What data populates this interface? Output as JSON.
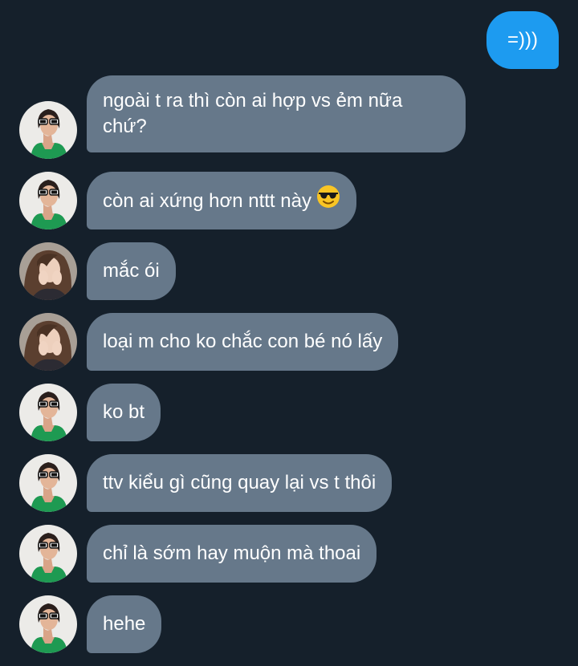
{
  "colors": {
    "background": "#15202b",
    "sent_bubble": "#1d9bf0",
    "received_bubble": "#66788a",
    "text": "#ffffff"
  },
  "conversation": {
    "sent": [
      {
        "text": "=)))"
      }
    ],
    "received": [
      {
        "text": "ngoài t ra thì còn ai hợp vs ẻm nữa chứ?",
        "avatar": "sunglasses-woman-avatar"
      },
      {
        "text": "còn ai xứng hơn nttt này",
        "emoji": "smiling-face-with-sunglasses-emoji",
        "avatar": "sunglasses-woman-avatar"
      },
      {
        "text": "mắc ói",
        "avatar": "long-hair-woman-avatar"
      },
      {
        "text": "loại m cho ko chắc con bé nó lấy",
        "avatar": "long-hair-woman-avatar"
      },
      {
        "text": "ko bt",
        "avatar": "sunglasses-woman-avatar"
      },
      {
        "text": "ttv kiểu gì cũng quay lại vs t thôi",
        "avatar": "sunglasses-woman-avatar"
      },
      {
        "text": "chỉ là sớm hay muộn mà thoai",
        "avatar": "sunglasses-woman-avatar"
      },
      {
        "text": "hehe",
        "avatar": "sunglasses-woman-avatar"
      }
    ]
  }
}
